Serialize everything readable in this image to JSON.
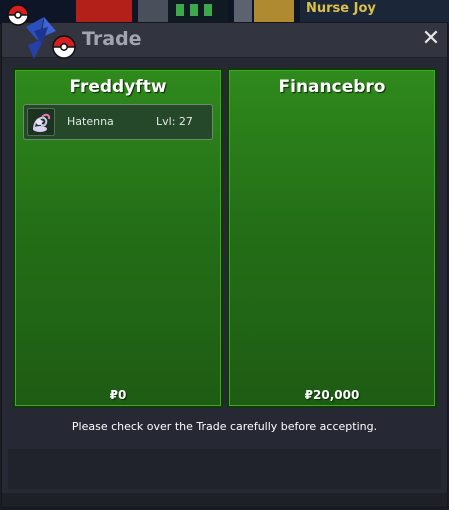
{
  "background": {
    "nameplate_text": "Nurse Joy",
    "colors": {
      "accent_yellow": "#d9c04a",
      "dark_blue": "#0e1526",
      "red": "#b3201a",
      "green": "#2f8a1c"
    }
  },
  "window": {
    "title": "Trade",
    "close_label": "✕",
    "logo_icon": "pokeball-cluster-icon"
  },
  "left_panel": {
    "trainer_name": "Freddyftw",
    "pokemon": [
      {
        "icon": "hatenna-icon",
        "name": "Hatenna",
        "level": "Lvl: 27"
      }
    ],
    "money": "₽0"
  },
  "right_panel": {
    "trainer_name": "Financebro",
    "pokemon": [],
    "money": "₽20,000"
  },
  "notice": "Please check over the Trade carefully before accepting."
}
